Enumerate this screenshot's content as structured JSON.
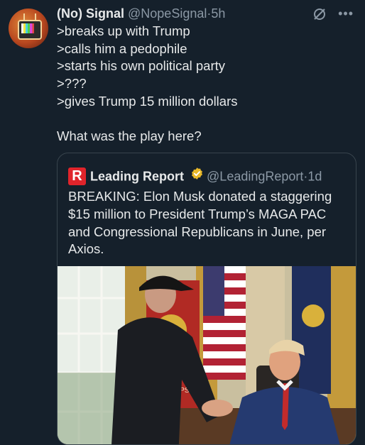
{
  "tweet": {
    "author_name": "(No) Signal",
    "author_handle": "@NopeSignal",
    "separator": "·",
    "time": "5h",
    "avatar_icon": "retro-tv-icon",
    "lines": [
      ">breaks up with Trump",
      ">calls him a pedophile",
      ">starts his own political party",
      ">???",
      ">gives Trump 15 million dollars",
      "",
      "What was the play here?"
    ]
  },
  "quoted": {
    "logo_letter": "R",
    "logo_color": "#e0242b",
    "author_name": "Leading Report",
    "verified_badge": "gold-check-icon",
    "author_handle": "@LeadingReport",
    "separator": "·",
    "time": "1d",
    "lines": [
      "BREAKING: Elon Musk donated a staggering",
      "$15 million to President Trump’s MAGA PAC",
      "and Congressional Republicans in June, per",
      "Axios."
    ],
    "media_icon": "photo-handshake-oval-office"
  },
  "colors": {
    "background": "#15202b",
    "text": "#e7e9ea",
    "muted": "#8b98a5",
    "border": "#38444d"
  }
}
